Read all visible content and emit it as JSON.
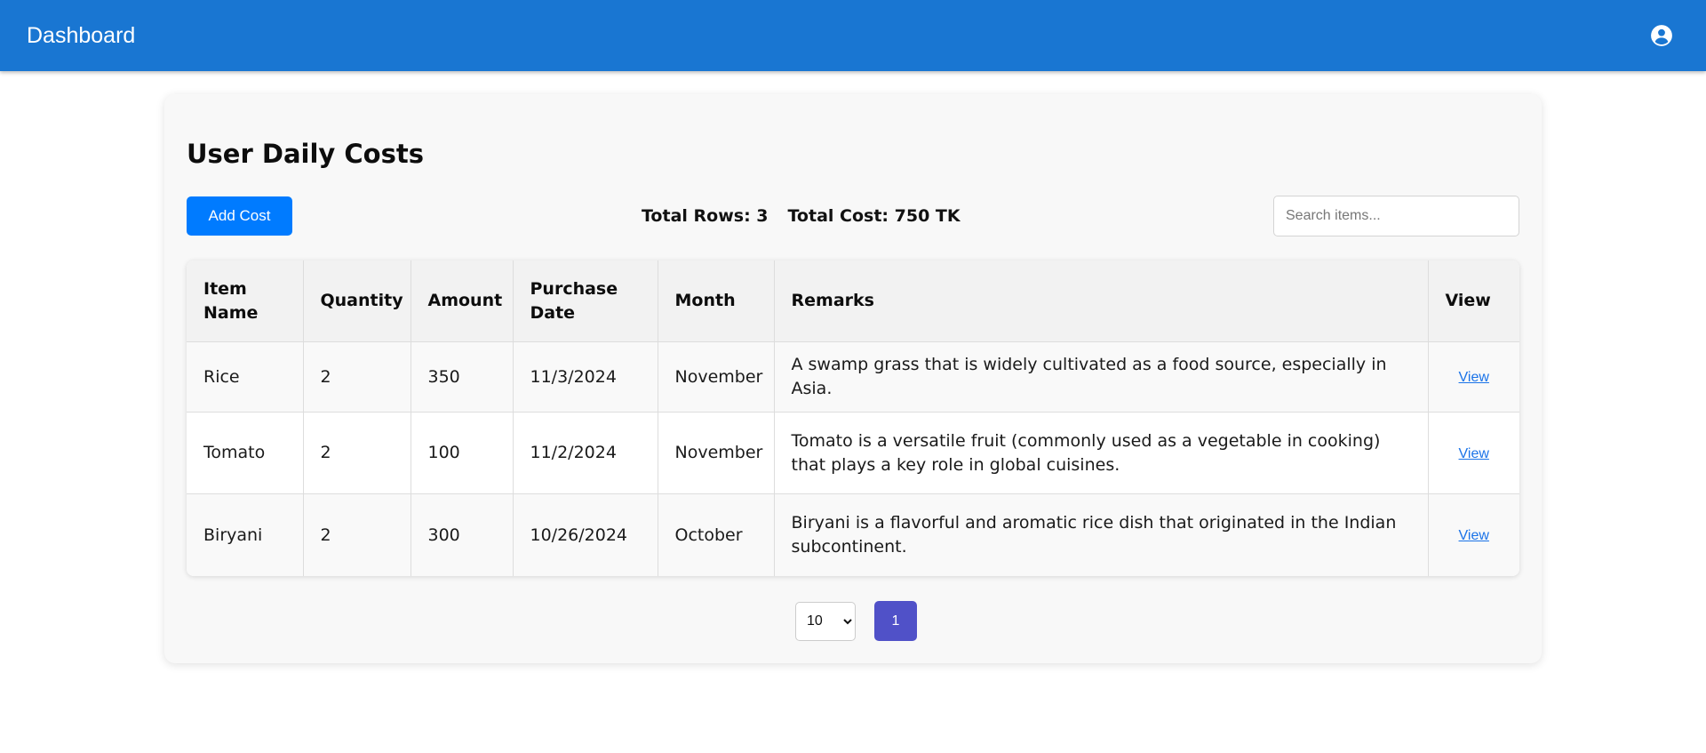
{
  "appbar": {
    "title": "Dashboard",
    "account_icon": "account-circle-icon"
  },
  "page": {
    "title": "User Daily Costs",
    "add_button_label": "Add Cost",
    "total_rows": "Total Rows: 3",
    "total_cost": "Total Cost: 750 TK",
    "search_placeholder": "Search items..."
  },
  "table": {
    "headers": [
      "Item Name",
      "Quantity",
      "Amount",
      "Purchase Date",
      "Month",
      "Remarks",
      "View"
    ],
    "rows": [
      {
        "item_name": "Rice",
        "quantity": "2",
        "amount": "350",
        "purchase_date": "11/3/2024",
        "month": "November",
        "remarks": "A swamp grass that is widely cultivated as a food source, especially in Asia.",
        "view_label": "View"
      },
      {
        "item_name": "Tomato",
        "quantity": "2",
        "amount": "100",
        "purchase_date": "11/2/2024",
        "month": "November",
        "remarks": "Tomato is a versatile fruit (commonly used as a vegetable in cooking) that plays a key role in global cuisines.",
        "view_label": "View"
      },
      {
        "item_name": "Biryani",
        "quantity": "2",
        "amount": "300",
        "purchase_date": "10/26/2024",
        "month": "October",
        "remarks": "Biryani is a flavorful and aromatic rice dish that originated in the Indian subcontinent.",
        "view_label": "View"
      }
    ]
  },
  "pagination": {
    "page_size": "10",
    "current_page": "1"
  },
  "colors": {
    "appbar": "#1976d2",
    "add_button": "#007bff",
    "active_page": "#5051c8",
    "link": "#1a73e8"
  }
}
